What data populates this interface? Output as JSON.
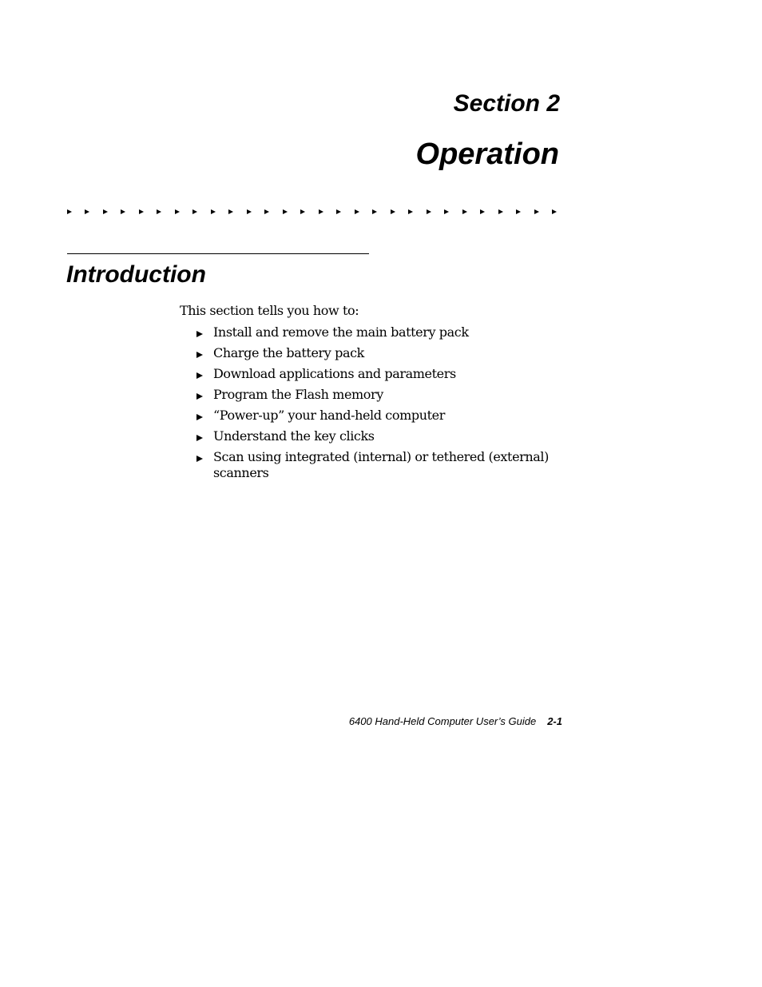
{
  "header": {
    "section_label": "Section 2",
    "chapter_title": "Operation"
  },
  "divider": {
    "arrow_count": 28,
    "icon": "right-triangle-arrow"
  },
  "introduction": {
    "heading": "Introduction",
    "lead": "This section tells you how to:",
    "bullet_icon": "right-triangle-bullet",
    "items": [
      "Install and remove the main battery pack",
      "Charge the battery pack",
      "Download applications and parameters",
      "Program the Flash memory",
      "“Power-up” your hand-held computer",
      "Understand the key clicks",
      "Scan using integrated (internal) or tethered (external) scanners"
    ]
  },
  "footer": {
    "guide_title": "6400 Hand-Held Computer User’s Guide",
    "page_number": "2-1"
  }
}
